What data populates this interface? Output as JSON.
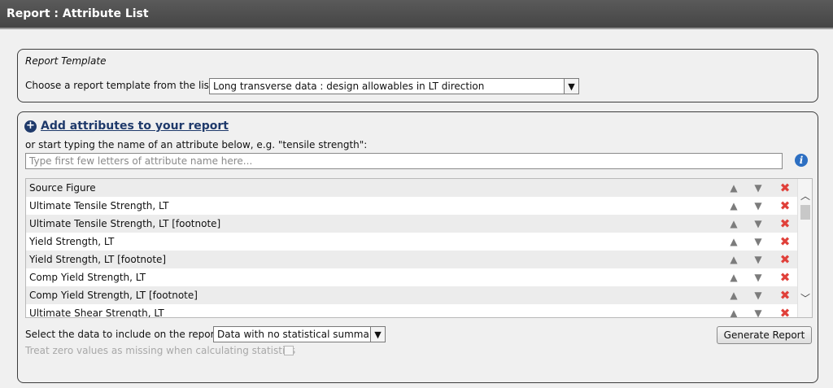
{
  "window": {
    "title": "Report : Attribute List"
  },
  "template_panel": {
    "heading": "Report Template",
    "label": "Choose a report template from the list.",
    "selected": "Long transverse data : design allowables in LT direction"
  },
  "attributes_panel": {
    "add_link": "Add attributes to your report",
    "hint": "or start typing the name of an attribute below, e.g. \"tensile strength\":",
    "search_placeholder": "Type first few letters of attribute name here...",
    "items": [
      {
        "label": "Source Figure"
      },
      {
        "label": "Ultimate Tensile Strength, LT"
      },
      {
        "label": "Ultimate Tensile Strength, LT [footnote]"
      },
      {
        "label": "Yield Strength, LT"
      },
      {
        "label": "Yield Strength, LT [footnote]"
      },
      {
        "label": "Comp Yield Strength, LT"
      },
      {
        "label": "Comp Yield Strength, LT [footnote]"
      },
      {
        "label": "Ultimate Shear Strength, LT"
      }
    ],
    "icons": {
      "move_up": "▲",
      "move_down": "▼",
      "remove": "✖"
    }
  },
  "footer": {
    "data_label": "Select the data to include on the report:",
    "data_selected": "Data with no statistical summary",
    "generate_button": "Generate Report",
    "zero_values_label": "Treat zero values as missing when calculating statistics"
  },
  "colors": {
    "titlebar": "#4e4e4e",
    "link": "#1f3a6b",
    "delete": "#e0403a",
    "info": "#2d6fc2"
  }
}
